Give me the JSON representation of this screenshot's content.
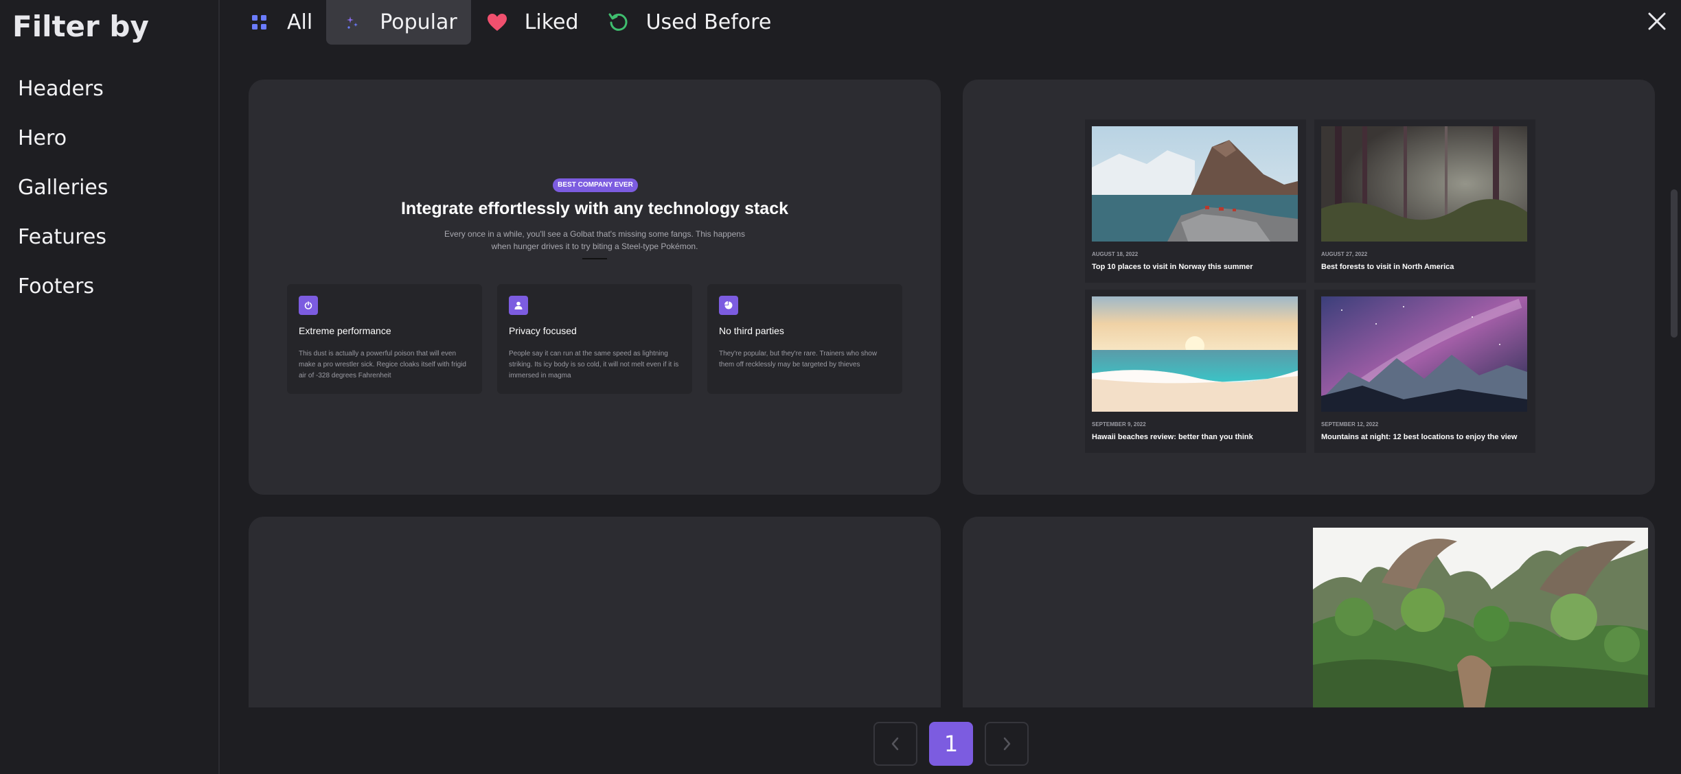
{
  "sidebar": {
    "title": "Filter by",
    "items": [
      {
        "label": "Headers"
      },
      {
        "label": "Hero"
      },
      {
        "label": "Galleries"
      },
      {
        "label": "Features"
      },
      {
        "label": "Footers"
      }
    ]
  },
  "tabs": [
    {
      "label": "All",
      "icon": "grid-icon",
      "active": false
    },
    {
      "label": "Popular",
      "icon": "sparkle-icon",
      "active": true
    },
    {
      "label": "Liked",
      "icon": "heart-icon",
      "active": false
    },
    {
      "label": "Used Before",
      "icon": "refresh-icon",
      "active": false
    }
  ],
  "feature_preview": {
    "badge": "BEST COMPANY EVER",
    "title": "Integrate effortlessly with any technology stack",
    "subtitle": "Every once in a while, you'll see a Golbat that's missing some fangs. This happens when hunger drives it to try biting a Steel-type Pokémon.",
    "features": [
      {
        "title": "Extreme performance",
        "description": "This dust is actually a powerful poison that will even make a pro wrestler sick. Regice cloaks itself with frigid air of -328 degrees Fahrenheit"
      },
      {
        "title": "Privacy focused",
        "description": "People say it can run at the same speed as lightning striking. Its icy body is so cold, it will not melt even if it is immersed in magma"
      },
      {
        "title": "No third parties",
        "description": "They're popular, but they're rare. Trainers who show them off recklessly may be targeted by thieves"
      }
    ]
  },
  "gallery_preview": {
    "items": [
      {
        "date": "AUGUST 18, 2022",
        "title": "Top 10 places to visit in Norway this summer"
      },
      {
        "date": "AUGUST 27, 2022",
        "title": "Best forests to visit in North America"
      },
      {
        "date": "SEPTEMBER 9, 2022",
        "title": "Hawaii beaches review: better than you think"
      },
      {
        "date": "SEPTEMBER 12, 2022",
        "title": "Mountains at night: 12 best locations to enjoy the view"
      }
    ]
  },
  "pagination": {
    "current_page": "1"
  },
  "colors": {
    "accent": "#7c5ce0",
    "background": "#1e1e22",
    "card": "#2c2c31",
    "heart": "#f0506e",
    "refresh": "#3fbf6f"
  }
}
